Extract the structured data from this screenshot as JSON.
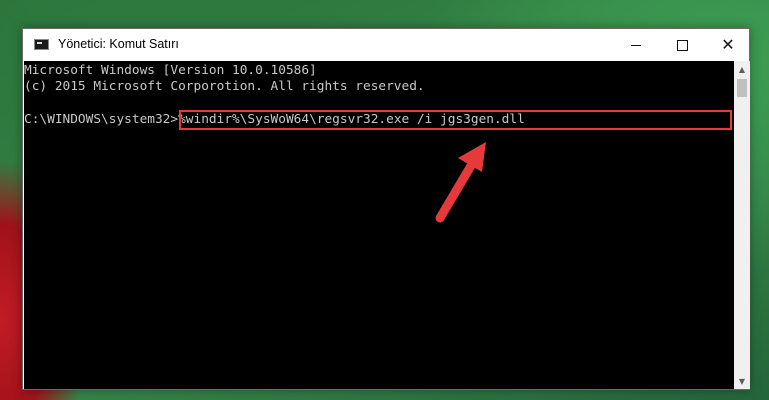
{
  "window": {
    "title": "Yönetici: Komut Satırı",
    "controls": {
      "minimize": "minimize-icon",
      "maximize": "maximize-icon",
      "close": "✕"
    }
  },
  "console": {
    "lines": [
      "Microsoft Windows [Version 10.0.10586]",
      "(c) 2015 Microsoft Corporotion. All rights reserved.",
      "",
      "C:\\WINDOWS\\system32>%windir%\\SysWoW64\\regsvr32.exe /i jgs3gen.dll"
    ],
    "prompt": "C:\\WINDOWS\\system32>",
    "command": "%windir%\\SysWoW64\\regsvr32.exe /i jgs3gen.dll"
  },
  "scrollbar": {
    "up": "▲",
    "down": "▼"
  },
  "annotation": {
    "highlight_color": "#e6393b",
    "arrow_color": "#e6393b"
  }
}
